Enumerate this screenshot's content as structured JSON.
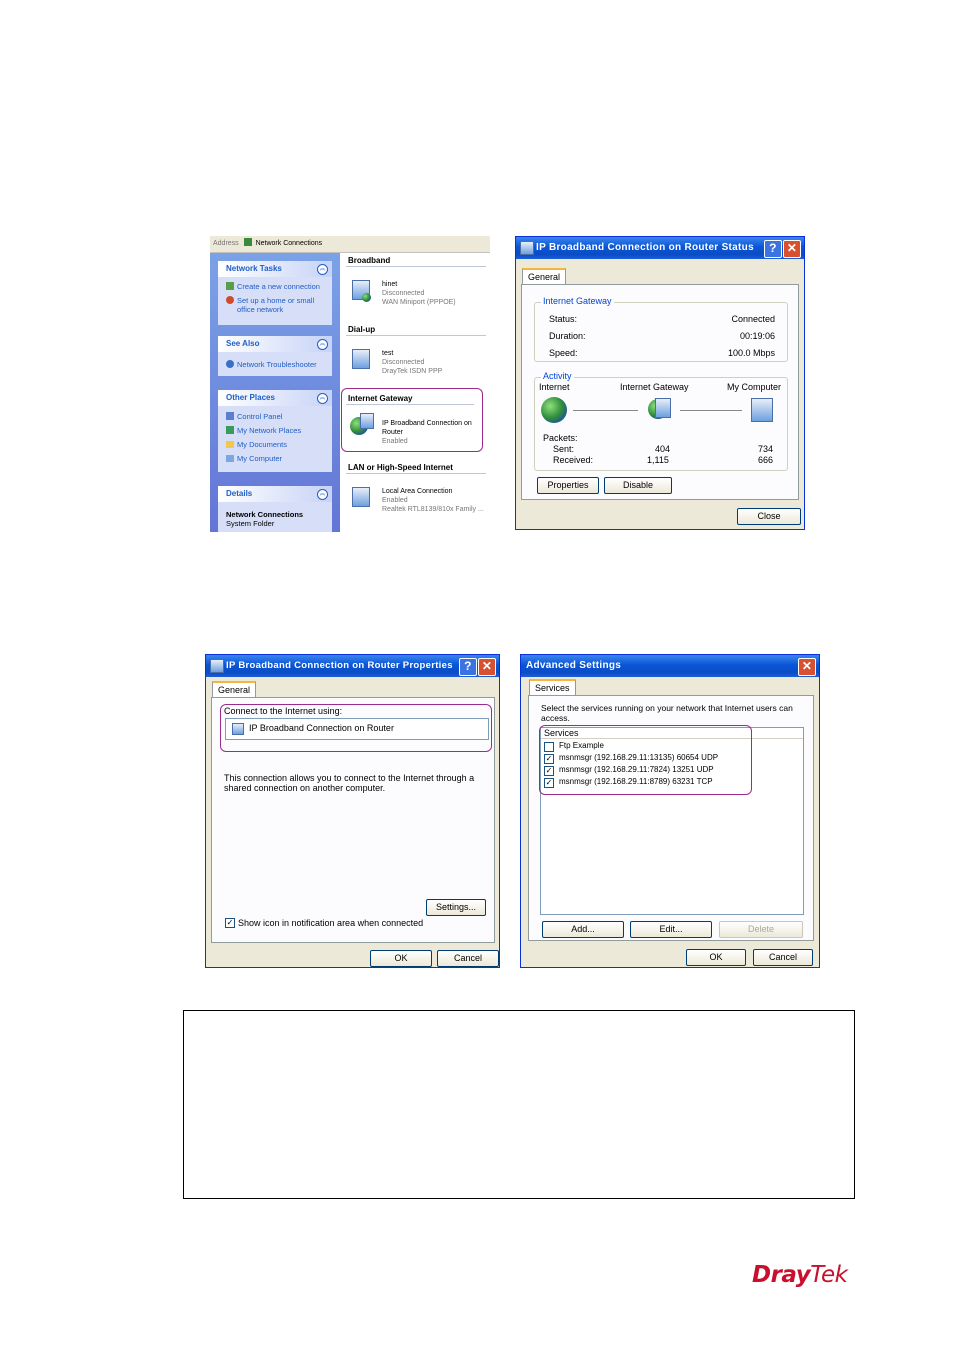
{
  "network_connections": {
    "address_label": "Address",
    "address_value": "Network Connections",
    "network_tasks": {
      "title": "Network Tasks",
      "items": [
        "Create a new connection",
        "Set up a home or small",
        "office network"
      ]
    },
    "see_also": {
      "title": "See Also",
      "items": [
        "Network Troubleshooter"
      ]
    },
    "other_places": {
      "title": "Other Places",
      "items": [
        "Control Panel",
        "My Network Places",
        "My Documents",
        "My Computer"
      ]
    },
    "details": {
      "title": "Details",
      "name": "Network Connections",
      "type": "System Folder"
    },
    "sections": {
      "broadband": "Broadband",
      "dialup": "Dial-up",
      "internet_gateway": "Internet Gateway",
      "lan": "LAN or High-Speed Internet"
    },
    "connections": {
      "hinet": {
        "name": "hinet",
        "status": "Disconnected",
        "device": "WAN Miniport (PPPOE)"
      },
      "test": {
        "name": "test",
        "status": "Disconnected",
        "device": "DrayTek ISDN PPP"
      },
      "gateway": {
        "name": "IP Broadband Connection on",
        "name2": "Router",
        "status": "Enabled"
      },
      "lan": {
        "name": "Local Area Connection",
        "status": "Enabled",
        "device": "Realtek RTL8139/810x Family ..."
      }
    }
  },
  "status_dialog": {
    "title": "IP Broadband Connection on Router Status",
    "tab": "General",
    "gateway_group": "Internet Gateway",
    "status_label": "Status:",
    "status_value": "Connected",
    "duration_label": "Duration:",
    "duration_value": "00:19:06",
    "speed_label": "Speed:",
    "speed_value": "100.0 Mbps",
    "activity_group": "Activity",
    "col_internet": "Internet",
    "col_gateway": "Internet Gateway",
    "col_computer": "My Computer",
    "packets_label": "Packets:",
    "sent_label": "Sent:",
    "sent_gateway": "404",
    "sent_computer": "734",
    "received_label": "Received:",
    "received_gateway": "1,115",
    "received_computer": "666",
    "properties_button": "Properties",
    "disable_button": "Disable",
    "close_button": "Close"
  },
  "properties_dialog": {
    "title": "IP Broadband Connection on Router Properties",
    "tab": "General",
    "connect_label": "Connect to the Internet using:",
    "connection_name": "IP Broadband Connection on Router",
    "description": "This connection allows you to connect to the Internet through a shared connection on another computer.",
    "settings_button": "Settings...",
    "show_icon_label": "Show icon in notification area when connected",
    "ok_button": "OK",
    "cancel_button": "Cancel"
  },
  "advanced_dialog": {
    "title": "Advanced Settings",
    "tab": "Services",
    "instruction": "Select the services running on your network that Internet users can access.",
    "services_label": "Services",
    "services": [
      {
        "label": "Ftp Example",
        "checked": false
      },
      {
        "label": "msnmsgr (192.168.29.11:13135) 60654 UDP",
        "checked": true
      },
      {
        "label": "msnmsgr (192.168.29.11:7824) 13251 UDP",
        "checked": true
      },
      {
        "label": "msnmsgr (192.168.29.11:8789) 63231 TCP",
        "checked": true
      }
    ],
    "add_button": "Add...",
    "edit_button": "Edit...",
    "delete_button": "Delete",
    "ok_button": "OK",
    "cancel_button": "Cancel"
  },
  "brand": {
    "part1": "Dray",
    "part2": "Tek",
    "color": "#c8102e"
  }
}
